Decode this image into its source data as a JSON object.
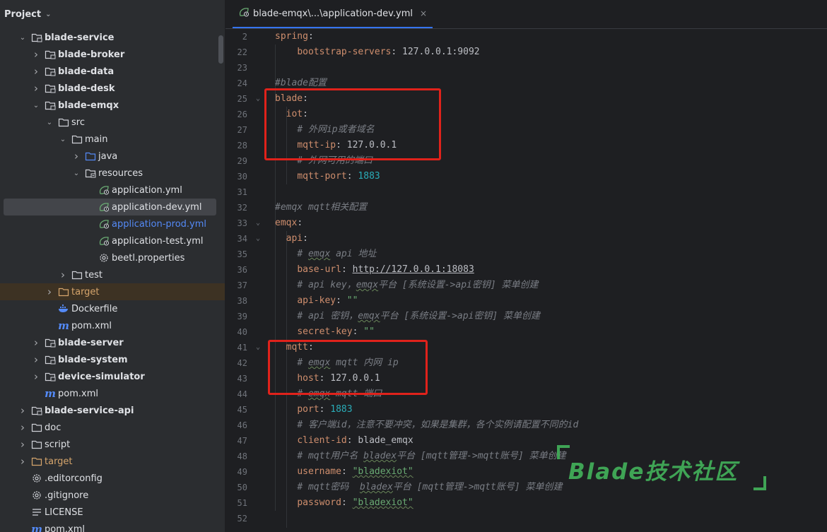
{
  "sidebar": {
    "header": {
      "title": "Project"
    },
    "tree": [
      {
        "label": "blade-service",
        "depth": 1,
        "arrow": "down",
        "icon": "module-folder",
        "bold": true
      },
      {
        "label": "blade-broker",
        "depth": 2,
        "arrow": "right",
        "icon": "module-folder",
        "bold": true
      },
      {
        "label": "blade-data",
        "depth": 2,
        "arrow": "right",
        "icon": "module-folder",
        "bold": true
      },
      {
        "label": "blade-desk",
        "depth": 2,
        "arrow": "right",
        "icon": "module-folder",
        "bold": true
      },
      {
        "label": "blade-emqx",
        "depth": 2,
        "arrow": "down",
        "icon": "module-folder",
        "bold": true
      },
      {
        "label": "src",
        "depth": 3,
        "arrow": "down",
        "icon": "folder"
      },
      {
        "label": "main",
        "depth": 4,
        "arrow": "down",
        "icon": "folder"
      },
      {
        "label": "java",
        "depth": 5,
        "arrow": "right",
        "icon": "source-folder"
      },
      {
        "label": "resources",
        "depth": 5,
        "arrow": "down",
        "icon": "resources-folder"
      },
      {
        "label": "application.yml",
        "depth": 6,
        "arrow": "none",
        "icon": "spring-yml"
      },
      {
        "label": "application-dev.yml",
        "depth": 6,
        "arrow": "none",
        "icon": "spring-yml",
        "selected": true
      },
      {
        "label": "application-prod.yml",
        "depth": 6,
        "arrow": "none",
        "icon": "spring-yml",
        "color": "blue"
      },
      {
        "label": "application-test.yml",
        "depth": 6,
        "arrow": "none",
        "icon": "spring-yml"
      },
      {
        "label": "beetl.properties",
        "depth": 6,
        "arrow": "none",
        "icon": "gear"
      },
      {
        "label": "test",
        "depth": 4,
        "arrow": "right",
        "icon": "folder"
      },
      {
        "label": "target",
        "depth": 3,
        "arrow": "right",
        "icon": "excluded-folder",
        "color": "orange",
        "excluded": true
      },
      {
        "label": "Dockerfile",
        "depth": 3,
        "arrow": "none",
        "icon": "docker"
      },
      {
        "label": "pom.xml",
        "depth": 3,
        "arrow": "none",
        "icon": "maven"
      },
      {
        "label": "blade-server",
        "depth": 2,
        "arrow": "right",
        "icon": "module-folder",
        "bold": true
      },
      {
        "label": "blade-system",
        "depth": 2,
        "arrow": "right",
        "icon": "module-folder",
        "bold": true
      },
      {
        "label": "device-simulator",
        "depth": 2,
        "arrow": "right",
        "icon": "module-folder",
        "bold": true
      },
      {
        "label": "pom.xml",
        "depth": 2,
        "arrow": "none",
        "icon": "maven"
      },
      {
        "label": "blade-service-api",
        "depth": 1,
        "arrow": "right",
        "icon": "module-folder",
        "bold": true
      },
      {
        "label": "doc",
        "depth": 1,
        "arrow": "right",
        "icon": "folder"
      },
      {
        "label": "script",
        "depth": 1,
        "arrow": "right",
        "icon": "folder"
      },
      {
        "label": "target",
        "depth": 1,
        "arrow": "right",
        "icon": "excluded-folder",
        "color": "orange"
      },
      {
        "label": ".editorconfig",
        "depth": 1,
        "arrow": "none",
        "icon": "gear"
      },
      {
        "label": ".gitignore",
        "depth": 1,
        "arrow": "none",
        "icon": "gear"
      },
      {
        "label": "LICENSE",
        "depth": 1,
        "arrow": "none",
        "icon": "text-lines"
      },
      {
        "label": "pom.xml",
        "depth": 1,
        "arrow": "none",
        "icon": "maven"
      }
    ]
  },
  "editor": {
    "tab": {
      "title": "blade-emqx\\...\\application-dev.yml",
      "close": "×"
    },
    "lines": [
      {
        "n": "2",
        "fold": "",
        "segs": [
          {
            "t": "spring",
            "c": "k"
          },
          {
            "t": ":",
            "c": "v"
          }
        ]
      },
      {
        "n": "22",
        "fold": "",
        "segs": [
          {
            "t": "    "
          },
          {
            "t": "bootstrap-servers",
            "c": "k"
          },
          {
            "t": ": 127.0.0.1:9092",
            "c": "v"
          }
        ]
      },
      {
        "n": "23",
        "fold": "",
        "segs": []
      },
      {
        "n": "24",
        "fold": "",
        "segs": [
          {
            "t": "#blade配置",
            "c": "c"
          }
        ]
      },
      {
        "n": "25",
        "fold": "⌄",
        "segs": [
          {
            "t": "blade",
            "c": "k"
          },
          {
            "t": ":",
            "c": "v"
          }
        ]
      },
      {
        "n": "26",
        "fold": "",
        "segs": [
          {
            "t": "  "
          },
          {
            "t": "iot",
            "c": "k"
          },
          {
            "t": ":",
            "c": "v"
          }
        ]
      },
      {
        "n": "27",
        "fold": "",
        "segs": [
          {
            "t": "    "
          },
          {
            "t": "# 外网ip或者域名",
            "c": "c"
          }
        ]
      },
      {
        "n": "28",
        "fold": "",
        "segs": [
          {
            "t": "    "
          },
          {
            "t": "mqtt-ip",
            "c": "k"
          },
          {
            "t": ": 127.0.0.1",
            "c": "v"
          }
        ]
      },
      {
        "n": "29",
        "fold": "",
        "segs": [
          {
            "t": "    "
          },
          {
            "t": "# 外网可用的端口",
            "c": "c"
          }
        ]
      },
      {
        "n": "30",
        "fold": "",
        "segs": [
          {
            "t": "    "
          },
          {
            "t": "mqtt-port",
            "c": "k"
          },
          {
            "t": ": ",
            "c": "v"
          },
          {
            "t": "1883",
            "c": "n"
          }
        ]
      },
      {
        "n": "31",
        "fold": "",
        "segs": []
      },
      {
        "n": "32",
        "fold": "",
        "segs": [
          {
            "t": "#emqx mqtt相关配置",
            "c": "c"
          }
        ]
      },
      {
        "n": "33",
        "fold": "⌄",
        "segs": [
          {
            "t": "emqx",
            "c": "k"
          },
          {
            "t": ":",
            "c": "v"
          }
        ]
      },
      {
        "n": "34",
        "fold": "⌄",
        "segs": [
          {
            "t": "  "
          },
          {
            "t": "api",
            "c": "k"
          },
          {
            "t": ":",
            "c": "v"
          }
        ]
      },
      {
        "n": "35",
        "fold": "",
        "segs": [
          {
            "t": "    "
          },
          {
            "t": "# ",
            "c": "c"
          },
          {
            "t": "emqx",
            "c": "c sq"
          },
          {
            "t": " api 地址",
            "c": "c"
          }
        ]
      },
      {
        "n": "36",
        "fold": "",
        "segs": [
          {
            "t": "    "
          },
          {
            "t": "base-url",
            "c": "k"
          },
          {
            "t": ": ",
            "c": "v"
          },
          {
            "t": "http://127.0.0.1:18083",
            "c": "v u"
          }
        ]
      },
      {
        "n": "37",
        "fold": "",
        "segs": [
          {
            "t": "    "
          },
          {
            "t": "# api key，",
            "c": "c"
          },
          {
            "t": "emqx",
            "c": "c sq"
          },
          {
            "t": "平台 [系统设置->api密钥] 菜单创建",
            "c": "c"
          }
        ]
      },
      {
        "n": "38",
        "fold": "",
        "segs": [
          {
            "t": "    "
          },
          {
            "t": "api-key",
            "c": "k"
          },
          {
            "t": ": ",
            "c": "v"
          },
          {
            "t": "\"\"",
            "c": "s"
          }
        ]
      },
      {
        "n": "39",
        "fold": "",
        "segs": [
          {
            "t": "    "
          },
          {
            "t": "# api 密钥，",
            "c": "c"
          },
          {
            "t": "emqx",
            "c": "c sq"
          },
          {
            "t": "平台 [系统设置->api密钥] 菜单创建",
            "c": "c"
          }
        ]
      },
      {
        "n": "40",
        "fold": "",
        "segs": [
          {
            "t": "    "
          },
          {
            "t": "secret-key",
            "c": "k"
          },
          {
            "t": ": ",
            "c": "v"
          },
          {
            "t": "\"\"",
            "c": "s"
          }
        ]
      },
      {
        "n": "41",
        "fold": "⌄",
        "segs": [
          {
            "t": "  "
          },
          {
            "t": "mqtt",
            "c": "k"
          },
          {
            "t": ":",
            "c": "v"
          }
        ]
      },
      {
        "n": "42",
        "fold": "",
        "segs": [
          {
            "t": "    "
          },
          {
            "t": "# ",
            "c": "c"
          },
          {
            "t": "emqx",
            "c": "c sq"
          },
          {
            "t": " mqtt 内网 ip",
            "c": "c"
          }
        ]
      },
      {
        "n": "43",
        "fold": "",
        "segs": [
          {
            "t": "    "
          },
          {
            "t": "host",
            "c": "k"
          },
          {
            "t": ": 127.0.0.1",
            "c": "v"
          }
        ]
      },
      {
        "n": "44",
        "fold": "",
        "segs": [
          {
            "t": "    "
          },
          {
            "t": "# ",
            "c": "c"
          },
          {
            "t": "emqx",
            "c": "c sq"
          },
          {
            "t": " mqtt 端口",
            "c": "c"
          }
        ]
      },
      {
        "n": "45",
        "fold": "",
        "segs": [
          {
            "t": "    "
          },
          {
            "t": "port",
            "c": "k"
          },
          {
            "t": ": ",
            "c": "v"
          },
          {
            "t": "1883",
            "c": "n"
          }
        ]
      },
      {
        "n": "46",
        "fold": "",
        "segs": [
          {
            "t": "    "
          },
          {
            "t": "# 客户端id，注意不要冲突，如果是集群，各个实例请配置不同的id",
            "c": "c"
          }
        ]
      },
      {
        "n": "47",
        "fold": "",
        "segs": [
          {
            "t": "    "
          },
          {
            "t": "client-id",
            "c": "k"
          },
          {
            "t": ": blade_emqx",
            "c": "v"
          }
        ]
      },
      {
        "n": "48",
        "fold": "",
        "segs": [
          {
            "t": "    "
          },
          {
            "t": "# mqtt用户名 ",
            "c": "c"
          },
          {
            "t": "bladex",
            "c": "c sq"
          },
          {
            "t": "平台 [mqtt管理->mqtt账号] 菜单创建",
            "c": "c"
          }
        ]
      },
      {
        "n": "49",
        "fold": "",
        "segs": [
          {
            "t": "    "
          },
          {
            "t": "username",
            "c": "k"
          },
          {
            "t": ": ",
            "c": "v"
          },
          {
            "t": "\"bladexiot\"",
            "c": "s sq"
          }
        ]
      },
      {
        "n": "50",
        "fold": "",
        "segs": [
          {
            "t": "    "
          },
          {
            "t": "# mqtt密码  ",
            "c": "c"
          },
          {
            "t": "bladex",
            "c": "c sq"
          },
          {
            "t": "平台 [mqtt管理->mqtt账号] 菜单创建",
            "c": "c"
          }
        ]
      },
      {
        "n": "51",
        "fold": "",
        "segs": [
          {
            "t": "    "
          },
          {
            "t": "password",
            "c": "k"
          },
          {
            "t": ": ",
            "c": "v"
          },
          {
            "t": "\"bladexiot\"",
            "c": "s sq"
          }
        ]
      },
      {
        "n": "52",
        "fold": "",
        "segs": []
      }
    ]
  },
  "watermark": {
    "text": "Blade技术社区"
  },
  "colors": {
    "key": "#cf8e6d",
    "number": "#2aacb8",
    "string": "#6aab73",
    "comment": "#7a7e85",
    "highlight_box": "#e0221b",
    "watermark": "#3fa455"
  }
}
